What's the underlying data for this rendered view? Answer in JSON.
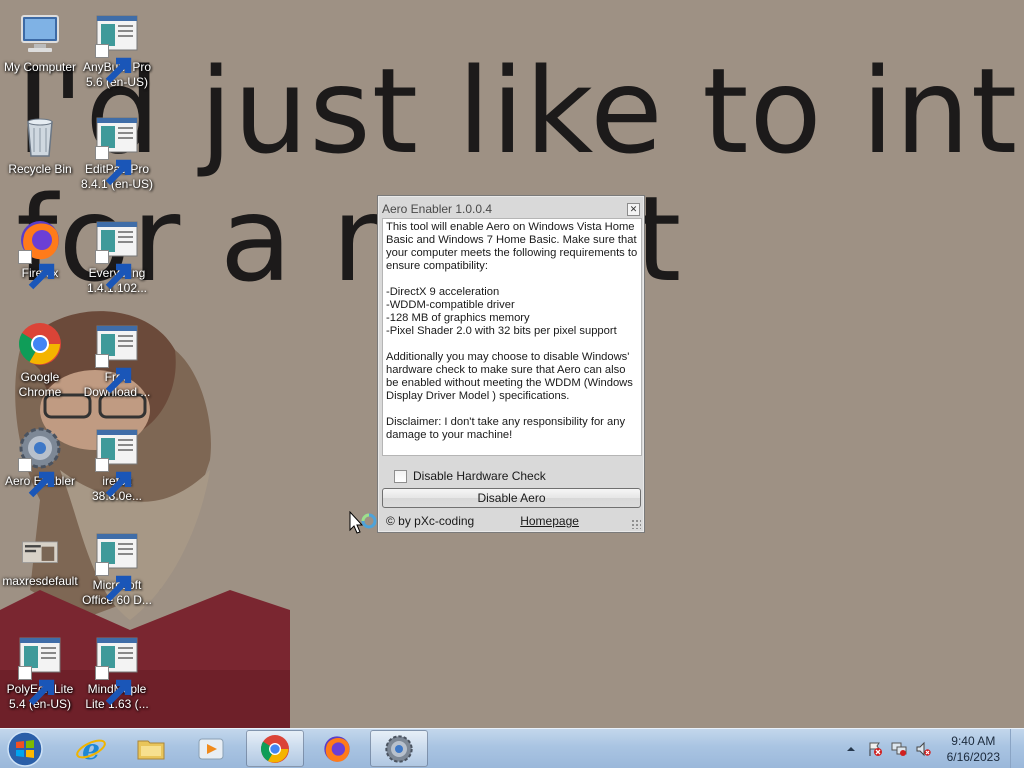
{
  "wallpaper": {
    "line1": "I'd just like to interje",
    "line2": "for a mo      nt"
  },
  "desktop": {
    "icons": [
      {
        "label": "My Computer",
        "icon": "computer-icon"
      },
      {
        "label": "AnyBurn Pro 5.6 (en-US)",
        "icon": "app-icon"
      },
      {
        "label": "Recycle Bin",
        "icon": "recycle-bin-icon"
      },
      {
        "label": "EditPad Pro 8.4.1 (en-US)",
        "icon": "app-icon"
      },
      {
        "label": "Firefox",
        "icon": "firefox-icon"
      },
      {
        "label": "Everything 1.4.1.102...",
        "icon": "app-icon"
      },
      {
        "label": "Google Chrome",
        "icon": "chrome-icon"
      },
      {
        "label": "Free Download ...",
        "icon": "app-icon"
      },
      {
        "label": "Aero Enabler",
        "icon": "gear-icon"
      },
      {
        "label": "irefox 38.8.0e...",
        "icon": "app-icon"
      },
      {
        "label": "maxresdefault",
        "icon": "image-icon"
      },
      {
        "label": "Microsoft Office 60 D...",
        "icon": "app-icon"
      },
      {
        "label": "PolyEdit Lite 5.4 (en-US)",
        "icon": "app-icon"
      },
      {
        "label": "MindMaple Lite 1.63 (...",
        "icon": "app-icon"
      }
    ]
  },
  "dialog": {
    "title": "Aero Enabler 1.0.0.4",
    "close_glyph": "✕",
    "body": "This tool will enable Aero on Windows Vista Home Basic and Windows 7 Home Basic. Make sure that your computer meets the following requirements to ensure compatibility:\n\n-DirectX 9 acceleration\n-WDDM-compatible driver\n-128 MB of graphics memory\n-Pixel Shader 2.0 with 32 bits per pixel support\n\nAdditionally you may choose to disable Windows' hardware check to make sure that Aero can also be enabled without meeting the WDDM (Windows Display Driver Model ) specifications.\n\nDisclaimer: I don't take any responsibility for any damage to your machine!",
    "checkbox_label": "Disable Hardware Check",
    "checkbox_checked": false,
    "button_label": "Disable Aero",
    "credit": "© by pXc-coding",
    "homepage_link": "Homepage"
  },
  "taskbar": {
    "items": [
      {
        "name": "internet-explorer",
        "active": false
      },
      {
        "name": "file-explorer",
        "active": false
      },
      {
        "name": "media-player",
        "active": false
      },
      {
        "name": "google-chrome",
        "active": true
      },
      {
        "name": "firefox",
        "active": false
      },
      {
        "name": "aero-enabler",
        "active": true
      }
    ],
    "time": "9:40 AM",
    "date": "6/16/2023"
  }
}
